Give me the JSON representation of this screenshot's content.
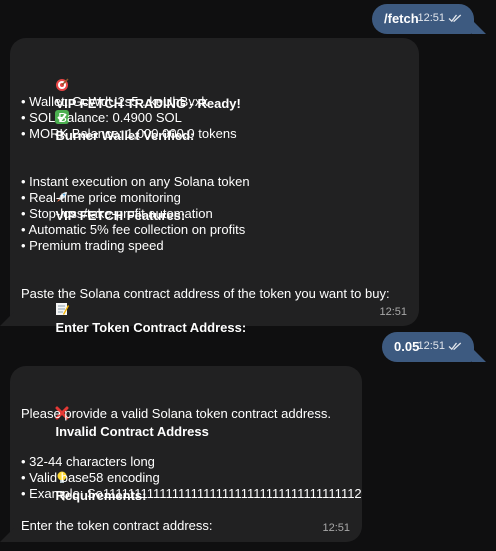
{
  "messages": {
    "m1": {
      "text": "/fetch",
      "time": "12:51"
    },
    "m2": {
      "title": "VIP FETCH TRADING - Ready!",
      "wallet_heading": "Burner Wallet Verified:",
      "wallet_lines": [
        "• Wallet: GcWdU2s5...keUhByxk",
        "• SOL Balance: 0.4900 SOL",
        "• MORK Balance: 1,000,000.0 tokens"
      ],
      "features_heading": "VIP FETCH Features:",
      "features_lines": [
        "• Instant execution on any Solana token",
        "• Real-time price monitoring",
        "• Stop-loss/take-profit automation",
        "• Automatic 5% fee collection on profits",
        "• Premium trading speed"
      ],
      "enter_heading": "Enter Token Contract Address:",
      "enter_text": "Paste the Solana contract address of the token you want to buy:",
      "time": "12:51"
    },
    "m3": {
      "text": "0.05",
      "time": "12:51"
    },
    "m4": {
      "title": "Invalid Contract Address",
      "message": "Please provide a valid Solana token contract address.",
      "req_heading": "Requirements:",
      "req_lines": [
        "• 32-44 characters long",
        "• Valid base58 encoding",
        "• Example: So11111111111111111111111111111111111111112"
      ],
      "prompt": "Enter the token contract address:",
      "time": "12:51"
    }
  },
  "colors": {
    "background": "#0f0f10",
    "incoming_bubble": "#212122",
    "outgoing_bubble": "#3d5a80"
  },
  "icons": {
    "m2_title": "target-icon",
    "m2_wallet": "check-mark-icon",
    "m2_features": "rocket-icon",
    "m2_enter": "memo-icon",
    "m4_title": "cross-mark-icon",
    "m4_req": "light-bulb-icon"
  }
}
